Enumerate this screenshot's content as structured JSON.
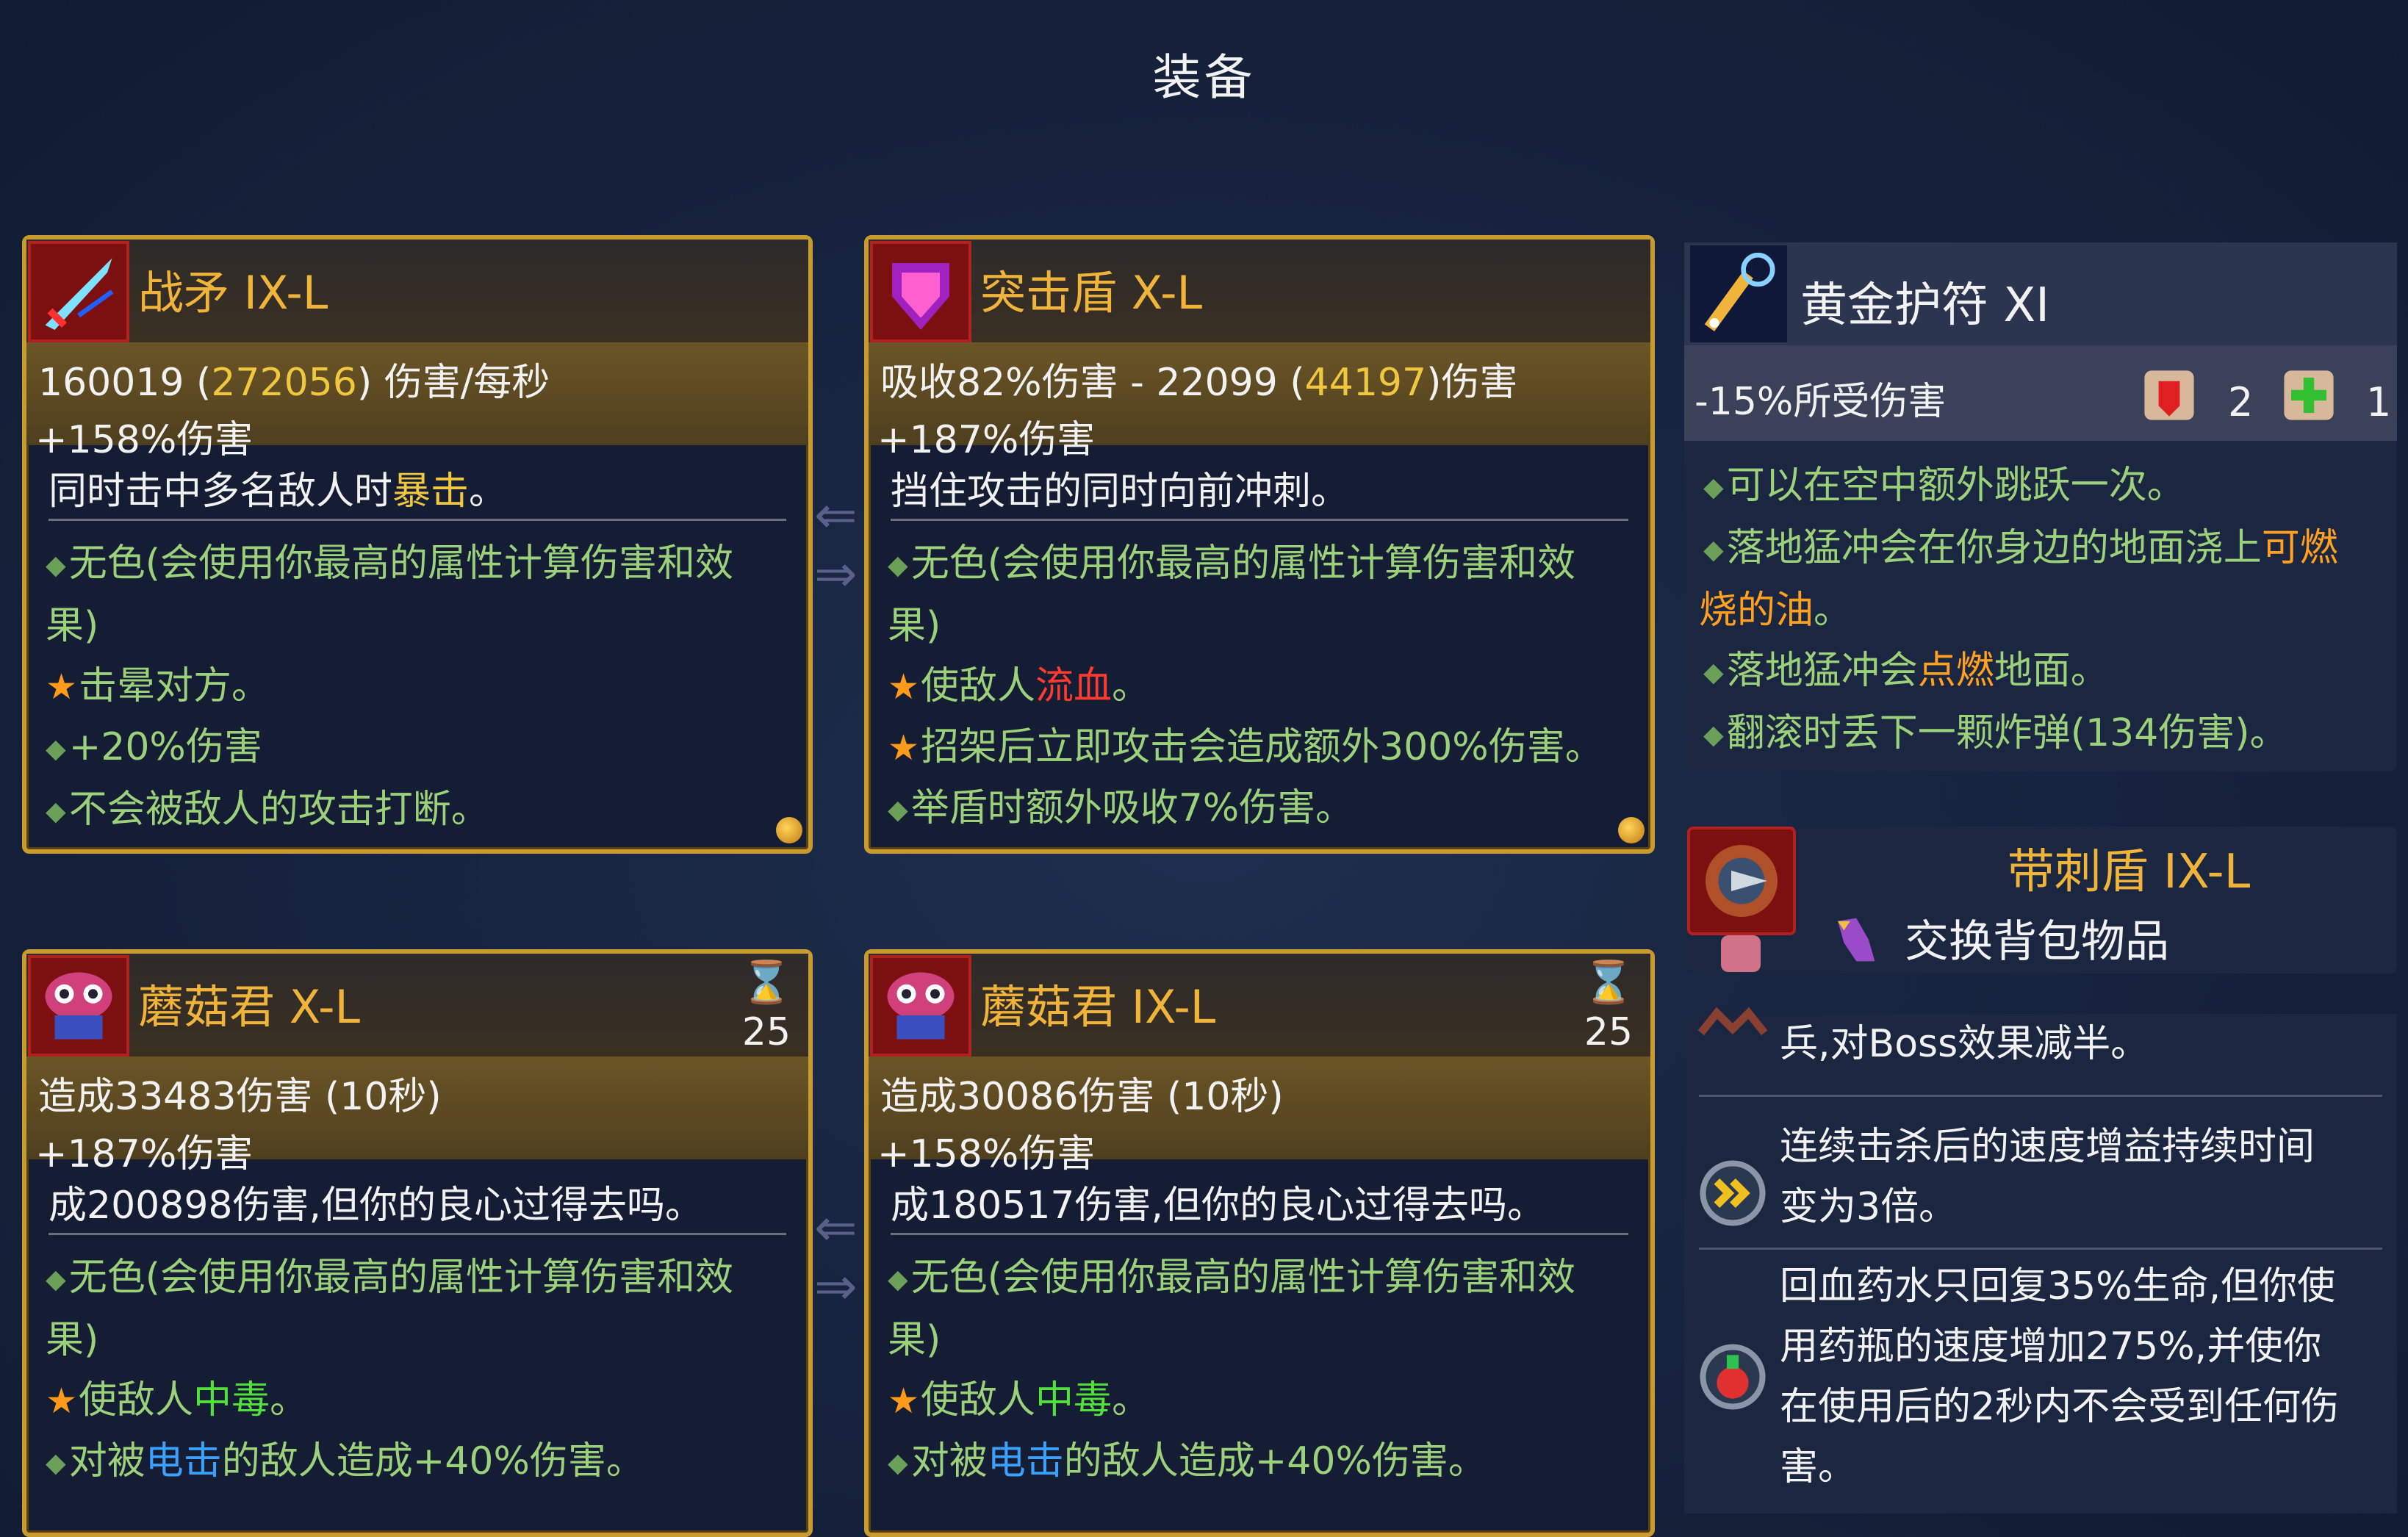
{
  "screen": {
    "title": "装备"
  },
  "cards": [
    {
      "name": "战矛 IX-L",
      "stat_main": "160019",
      "stat_paren_value": "272056",
      "stat_suffix": "伤害/每秒",
      "stat_bonus": "+158%伤害",
      "desc_prefix": "同时击中多名敌人时",
      "desc_highlight": "暴击",
      "desc_suffix": "。",
      "affix_color": "无色(会使用你最高的属性计算伤害和效果)",
      "affix_color_l1": "无色(会使用你最高的属性计算伤害和效",
      "affix_color_l2": "果)",
      "star_text_prefix": "击晕对方",
      "star_text_suffix": "。",
      "affix_2": "+20%伤害",
      "affix_3": "不会被敌人的攻击打断。"
    },
    {
      "name": "突击盾 X-L",
      "stat_main": "吸收82%伤害 - 22099",
      "stat_paren_value": "44197",
      "stat_suffix": "伤害",
      "stat_bonus": "+187%伤害",
      "desc": "挡住攻击的同时向前冲刺。",
      "affix_color_l1": "无色(会使用你最高的属性计算伤害和效",
      "affix_color_l2": "果)",
      "star1_prefix": "使敌人",
      "star1_highlight": "流血",
      "star1_suffix": "。",
      "star2": "招架后立即攻击会造成额外300%伤害。",
      "affix_3": "举盾时额外吸收7%伤害。"
    },
    {
      "name": "蘑菇君 X-L",
      "cooldown": "25",
      "stat_main": "造成33483伤害 (10秒)",
      "stat_bonus": "+187%伤害",
      "desc": "成200898伤害,但你的良心过得去吗。",
      "affix_color_l1": "无色(会使用你最高的属性计算伤害和效",
      "affix_color_l2": "果)",
      "star_prefix": "使敌人",
      "star_highlight": "中毒",
      "star_suffix": "。",
      "affix_4_prefix": "对被",
      "affix_4_highlight": "电击",
      "affix_4_suffix": "的敌人造成+40%伤害。"
    },
    {
      "name": "蘑菇君 IX-L",
      "cooldown": "25",
      "stat_main": "造成30086伤害 (10秒)",
      "stat_bonus": "+158%伤害",
      "desc": "成180517伤害,但你的良心过得去吗。",
      "affix_color_l1": "无色(会使用你最高的属性计算伤害和效",
      "affix_color_l2": "果)",
      "star_prefix": "使敌人",
      "star_highlight": "中毒",
      "star_suffix": "。",
      "affix_4_prefix": "对被",
      "affix_4_highlight": "电击",
      "affix_4_suffix": "的敌人造成+40%伤害。"
    }
  ],
  "amulet": {
    "name": "黄金护符 XI",
    "stat": "-15%所受伤害",
    "scroll_red_count": "2",
    "scroll_green_count": "1",
    "affix_1": "可以在空中额外跳跃一次。",
    "affix_2_prefix": "落地猛冲会在你身边的地面浇上",
    "affix_2_highlight_l1": "可燃",
    "affix_2_highlight_l2": "烧的油",
    "affix_2_suffix": "。",
    "affix_3_prefix": "落地猛冲会",
    "affix_3_highlight": "点燃",
    "affix_3_suffix": "地面。",
    "affix_4": "翻滚时丢下一颗炸弹(134伤害)。"
  },
  "spiked_shield": {
    "name": "带刺盾 IX-L",
    "swap_label": "交换背包物品"
  },
  "mutations": {
    "m1": "兵,对Boss效果减半。",
    "m2_l1": "连续击杀后的速度增益持续时间",
    "m2_l2": "变为3倍。",
    "m3_l1": "回血药水只回复35%生命,但你使",
    "m3_l2": "用药瓶的速度增加275%,并使你",
    "m3_l3": "在使用后的2秒内不会受到任何伤",
    "m3_l4": "害。"
  },
  "icons": {
    "spear": "spear-icon",
    "shield": "assault-shield-icon",
    "mushroom": "mushroom-boi-icon",
    "hourglass": "hourglass-icon",
    "amulet": "amulet-icon",
    "scroll_red": "brutality-scroll-icon",
    "scroll_green": "survival-scroll-icon",
    "spiked_shield": "spiked-shield-icon",
    "swap": "swap-backpack-icon",
    "arrows": "swap-arrows-icon"
  },
  "colors": {
    "item_name": "#f0b43b",
    "affix": "#9bd17a",
    "gold_value": "#f0c840",
    "bleed": "#ff3a2e",
    "poison": "#52e03a",
    "shock": "#3ca0ff",
    "fire": "#ffa020"
  }
}
